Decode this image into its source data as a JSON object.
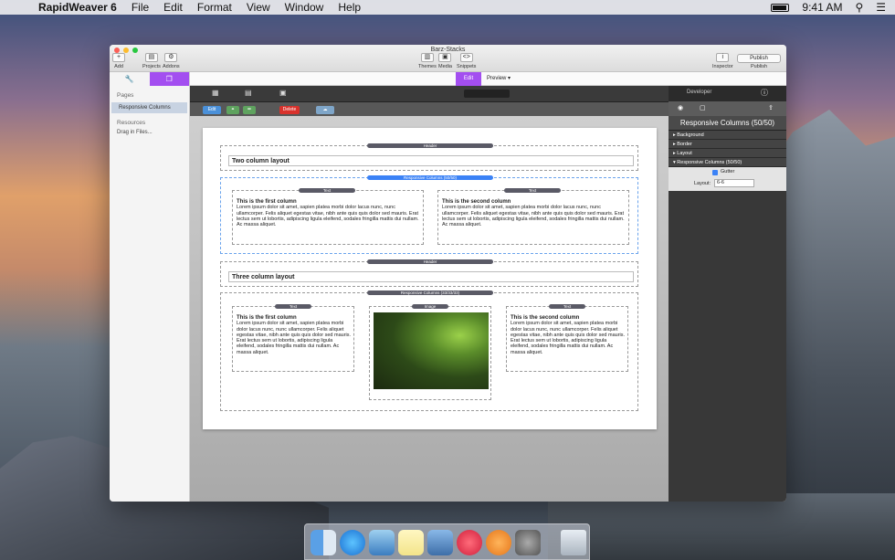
{
  "menubar": {
    "apple": "",
    "app": "RapidWeaver 6",
    "items": [
      "File",
      "Edit",
      "Format",
      "View",
      "Window",
      "Help"
    ],
    "time": "9:41 AM"
  },
  "window": {
    "title": "Barz-Stacks"
  },
  "toolbar": {
    "add": "Add",
    "projects": "Projects",
    "addons": "Addons",
    "themes": "Themes",
    "media": "Media",
    "snippets": "Snippets",
    "inspector": "Inspector",
    "publish_btn": "Publish",
    "publish": "Publish"
  },
  "sidebar": {
    "pages_header": "Pages",
    "page_item": "Responsive Columns",
    "resources_header": "Resources",
    "resource_item": "Drag in Files..."
  },
  "modes": {
    "edit": "Edit",
    "preview": "Preview"
  },
  "stack_toolbar": {
    "edit": "Edit",
    "delete": "Delete"
  },
  "inspector": {
    "developer": "Developer",
    "title": "Responsive Columns (50/50)",
    "sections": [
      "Background",
      "Border",
      "Layout",
      "Responsive Columns (50/50)"
    ],
    "gutter_label": "Gutter",
    "layout_label": "Layout:",
    "layout_value": "6-6"
  },
  "page": {
    "header_pill": "Header",
    "two_col_title": "Two column layout",
    "resp_pill_1": "Responsive Columns (50/50)",
    "text_pill": "Text",
    "image_pill": "Image",
    "first_col_title": "This is the first column",
    "second_col_title": "This is the second column",
    "lorem": "Lorem ipsum dolor sit amet, sapien platea morbi dolor lacus nunc, nunc ullamcorper. Felis aliquet egestas vitae, nibh ante quis quis dolor sed mauris. Erat lectus sem ut lobortis, adipiscing ligula eleifend, sodales fringilla mattis dui nullam. Ac massa aliquet.",
    "three_col_title": "Three column layout",
    "resp_pill_2": "Responsive Columns (33/33/33)"
  },
  "colors": {
    "accent": "#a34ef0",
    "selected": "#3b82f6",
    "delete": "#d9322c"
  }
}
